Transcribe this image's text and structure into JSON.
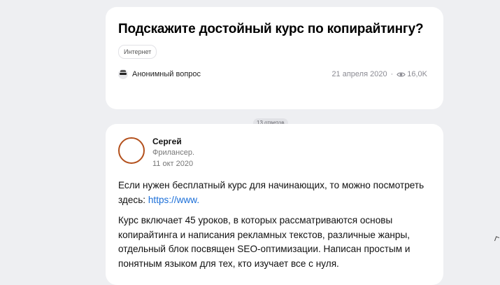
{
  "question": {
    "title": "Подскажите достойный курс по копирайтингу?",
    "tag": "Интернет",
    "author": "Анонимный вопрос",
    "date": "21 апреля 2020",
    "separator": "·",
    "views": "16,0K"
  },
  "answers_count": "13 ответов",
  "answer": {
    "author": "Сергей",
    "role": "Фрилансер.",
    "date": "11 окт 2020",
    "paragraph1_text": "Если нужен бесплатный курс для начинающих, то можно посмотреть здесь: ",
    "paragraph1_link": "https://www.",
    "paragraph2": "Курс включает 45 уроков, в которых рассматриваются основы копирайтинга и написания рекламных текстов, различные жанры, отдельный блок посвящен SEO-оптимизации. Написан простым и понятным языком для тех, кто изучает все с нуля."
  },
  "icons": {
    "anonymous": "anonymous-user-icon",
    "views": "eye-icon",
    "avatar": "avatar-circle"
  },
  "colors": {
    "background": "#eeeff2",
    "card": "#ffffff",
    "link": "#1a6ed8",
    "avatar_ring": "#b3501c",
    "muted_text": "#8b8b93"
  }
}
